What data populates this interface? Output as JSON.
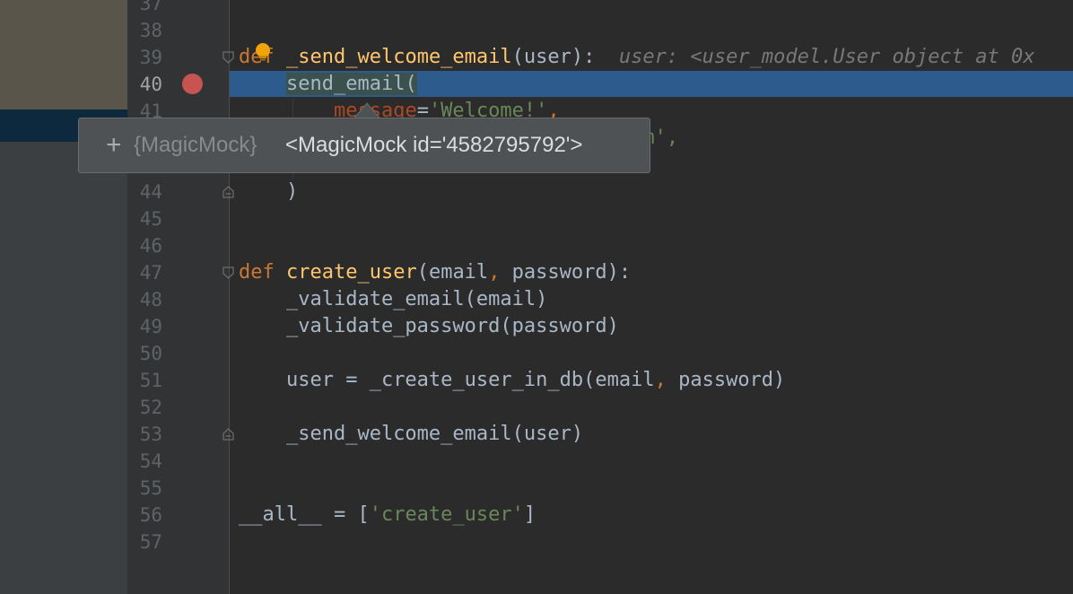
{
  "editor": {
    "line_numbers": [
      "37",
      "38",
      "39",
      "40",
      "41",
      "",
      "",
      "44",
      "45",
      "46",
      "47",
      "48",
      "49",
      "50",
      "51",
      "52",
      "53",
      "54",
      "55",
      "56",
      "57"
    ],
    "current_line": "40",
    "code": {
      "l39": {
        "kw": "def",
        "fn": "_send_welcome_email",
        "args": "(user):",
        "hint": "user: <user_model.User object at 0x"
      },
      "l40": {
        "call": "send_email",
        "paren": "("
      },
      "l41": {
        "param": "message",
        "eq": "=",
        "value": "'Welcome!'",
        "tail": ","
      },
      "l42": {
        "tail": "m',"
      },
      "l44": {
        "text": ")"
      },
      "l47": {
        "kw": "def",
        "fn": "create_user",
        "args_a": "(email",
        "comma": ",",
        "args_b": " password):"
      },
      "l48": {
        "text": "_validate_email(email)"
      },
      "l49": {
        "text": "_validate_password(password)"
      },
      "l51": {
        "a": "user = _create_user_in_db(email",
        "comma": ",",
        "b": " password)"
      },
      "l53": {
        "text": "_send_welcome_email(user)"
      },
      "l56": {
        "a": "__all__ = [",
        "value": "'create_user'",
        "b": "]"
      }
    }
  },
  "tooltip": {
    "expand_glyph": "+",
    "type_label": "{MagicMock}",
    "value": "<MagicMock id='4582795792'>"
  },
  "colors": {
    "background": "#2b2b2b",
    "gutter": "#313335",
    "execution_line": "#2d5b8e",
    "breakpoint": "#c75450",
    "keyword": "#cc7832",
    "function": "#ffc66d",
    "string": "#6a8759",
    "tooltip_bg": "#4e5254"
  },
  "icons": [
    "breakpoint-icon",
    "intention-bulb-icon",
    "fold-icon",
    "expand-icon"
  ]
}
